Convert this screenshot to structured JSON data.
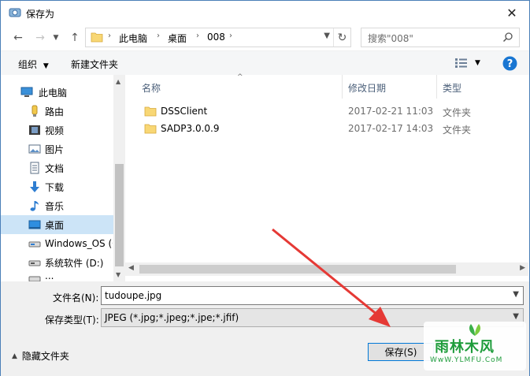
{
  "window": {
    "title": "保存为"
  },
  "navbar": {
    "breadcrumbs": [
      "此电脑",
      "桌面",
      "008"
    ],
    "search_placeholder": "搜索\"008\""
  },
  "toolbar": {
    "organize": "组织",
    "new_folder": "新建文件夹"
  },
  "nav_pane": {
    "items": [
      {
        "label": "此电脑",
        "icon": "computer-icon"
      },
      {
        "label": "路由",
        "icon": "router-folder-icon"
      },
      {
        "label": "视频",
        "icon": "video-icon"
      },
      {
        "label": "图片",
        "icon": "pictures-icon"
      },
      {
        "label": "文档",
        "icon": "documents-icon"
      },
      {
        "label": "下载",
        "icon": "download-icon"
      },
      {
        "label": "音乐",
        "icon": "music-icon"
      },
      {
        "label": "桌面",
        "icon": "desktop-icon",
        "selected": true
      },
      {
        "label": "Windows_OS (C",
        "icon": "drive-icon"
      },
      {
        "label": "系统软件 (D:)",
        "icon": "drive-icon"
      },
      {
        "label": "...",
        "icon": "drive-icon"
      }
    ]
  },
  "file_pane": {
    "columns": [
      "名称",
      "修改日期",
      "类型"
    ],
    "rows": [
      {
        "name": "DSSClient",
        "date": "2017-02-21 11:03",
        "type": "文件夹"
      },
      {
        "name": "SADP3.0.0.9",
        "date": "2017-02-17 14:03",
        "type": "文件夹"
      }
    ]
  },
  "form": {
    "filename_label": "文件名(N):",
    "filename_value": "tudoupe.jpg",
    "filetype_label": "保存类型(T):",
    "filetype_value": "JPEG (*.jpg;*.jpeg;*.jpe;*.jfif)"
  },
  "footer": {
    "hide_folders": "隐藏文件夹",
    "save": "保存(S)"
  },
  "watermark": {
    "title": "雨林木风",
    "url": "WwW.YLMFU.CoM"
  },
  "colors": {
    "selection": "#cce4f7",
    "accent": "#0078d7",
    "arrow": "#e53935",
    "folder": "#f8d775"
  }
}
